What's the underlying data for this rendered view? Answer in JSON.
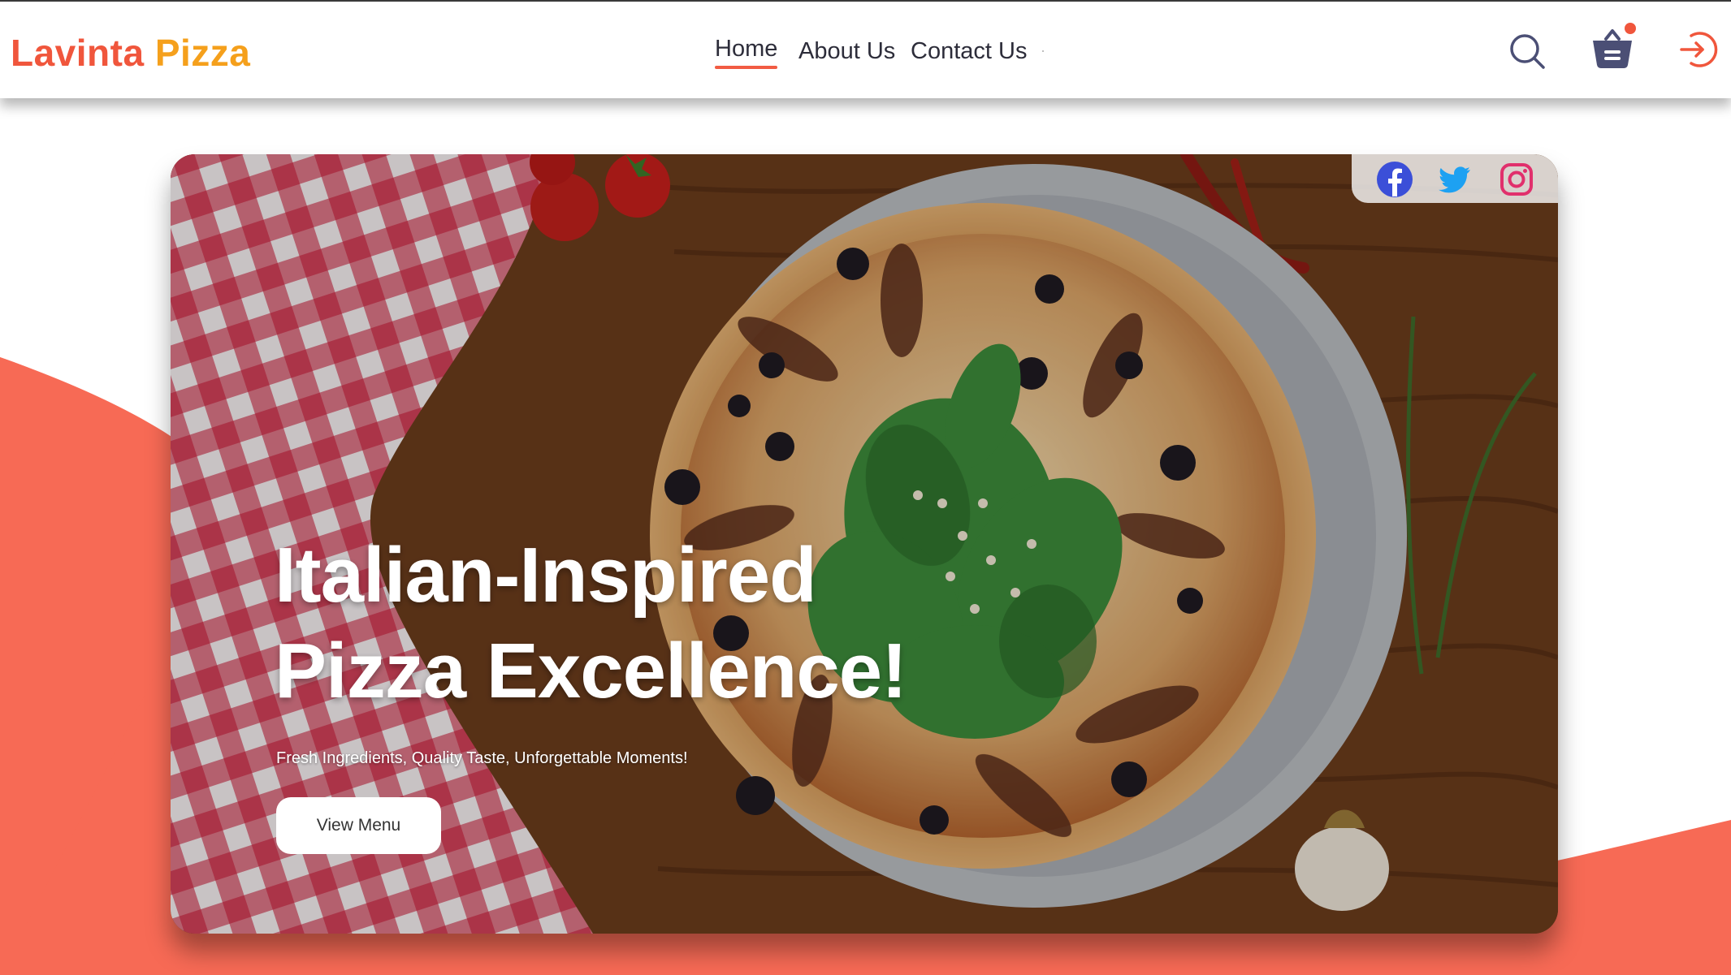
{
  "brand": {
    "name_part1": "Lavinta",
    "name_part2": "Pizza"
  },
  "nav": {
    "items": [
      {
        "label": "Home",
        "active": true
      },
      {
        "label": "About Us"
      },
      {
        "label": "Contact Us"
      }
    ]
  },
  "header_icons": [
    "search-icon",
    "basket-icon",
    "login-icon"
  ],
  "cart": {
    "has_notification": true
  },
  "social": [
    "facebook-icon",
    "twitter-icon",
    "instagram-icon"
  ],
  "hero": {
    "title_line1": "Italian-Inspired",
    "title_line2": "Pizza Excellence!",
    "subtitle": "Fresh Ingredients, Quality Taste, Unforgettable Moments!",
    "cta_label": "View Menu"
  },
  "colors": {
    "brand_red": "#f0563c",
    "brand_orange": "#f5a01c",
    "wave": "#f76a55",
    "text_dark": "#2d2d3a",
    "cart_icon": "#4b4f75",
    "facebook": "#3b4fd8",
    "twitter": "#1da1f2",
    "instagram": "#e1306c"
  }
}
